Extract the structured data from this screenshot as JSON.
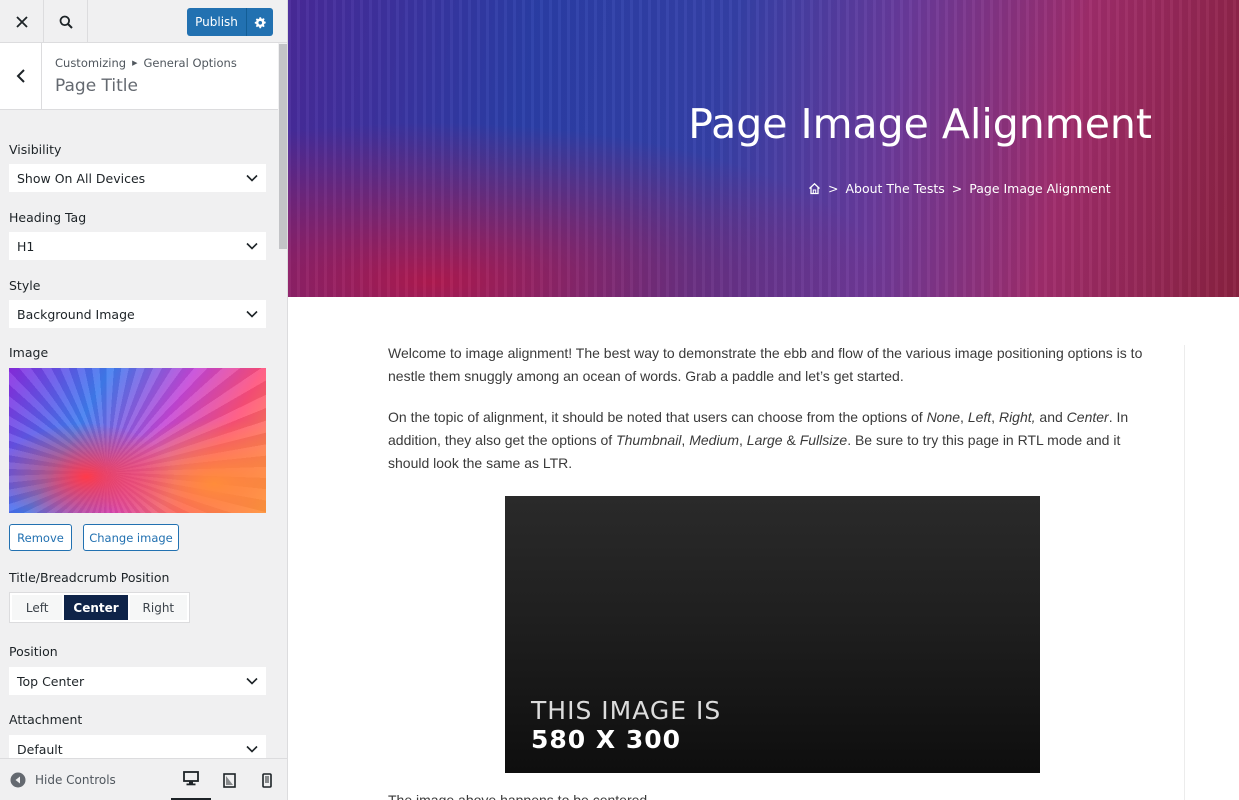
{
  "topbar": {
    "publish_label": "Publish"
  },
  "section": {
    "breadcrumb": [
      "Customizing",
      "General Options"
    ],
    "title": "Page Title"
  },
  "controls": {
    "visibility": {
      "label": "Visibility",
      "value": "Show On All Devices"
    },
    "heading_tag": {
      "label": "Heading Tag",
      "value": "H1"
    },
    "style": {
      "label": "Style",
      "value": "Background Image"
    },
    "image": {
      "label": "Image",
      "remove_label": "Remove",
      "change_label": "Change image"
    },
    "title_position": {
      "label": "Title/Breadcrumb Position",
      "options": [
        "Left",
        "Center",
        "Right"
      ],
      "selected": "Center"
    },
    "position": {
      "label": "Position",
      "value": "Top Center"
    },
    "attachment": {
      "label": "Attachment",
      "value": "Default"
    }
  },
  "footer": {
    "hide_controls_label": "Hide Controls",
    "devices": [
      "desktop",
      "tablet",
      "mobile"
    ],
    "active_device": "desktop"
  },
  "preview": {
    "page_title": "Page Image Alignment",
    "breadcrumb": {
      "home_icon": "home-icon",
      "sep": ">",
      "items": [
        "About The Tests",
        "Page Image Alignment"
      ]
    },
    "paragraph1": "Welcome to image alignment! The best way to demonstrate the ebb and flow of the various image positioning options is to nestle them snuggly among an ocean of words. Grab a paddle and let’s get started.",
    "paragraph2": {
      "a": "On the topic of alignment, it should be noted that users can choose from the options of ",
      "none": "None",
      "comma1": ", ",
      "left": "Left",
      "comma2": ", ",
      "right": "Right,",
      "and": " and ",
      "center": "Center",
      "b": ". In addition, they also get the options of ",
      "thumbnail": "Thumbnail",
      "comma3": ", ",
      "medium": "Medium",
      "comma4": ", ",
      "large": "Large",
      "amp": " & ",
      "fullsize": "Fullsize",
      "c": ". Be sure to try this page in RTL mode and it should look the same as LTR."
    },
    "image_text_line1": "THIS IMAGE IS",
    "image_text_line2": "580 X 300",
    "next_text": "The image above happens to be centered."
  },
  "colors": {
    "accent": "#2271b1",
    "active_toggle": "#0f2449"
  }
}
